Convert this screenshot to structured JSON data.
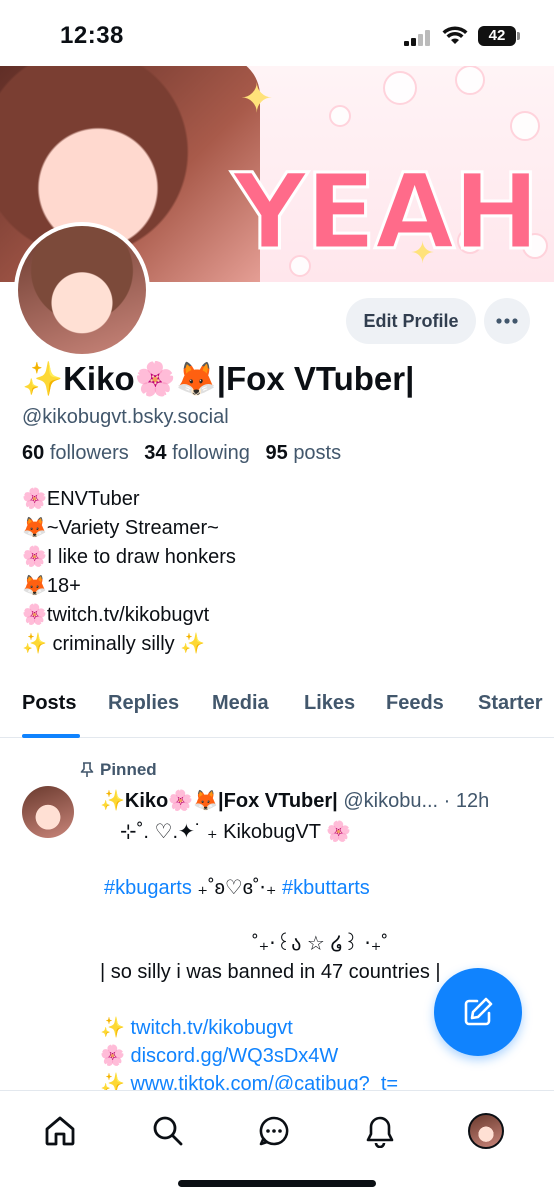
{
  "status_bar": {
    "time": "12:38",
    "battery": "42"
  },
  "profile": {
    "display_name": "✨Kiko🌸🦊|Fox VTuber|",
    "handle": "@kikobugvt.bsky.social",
    "edit_label": "Edit Profile",
    "followers_count": "60",
    "followers_label": "followers",
    "following_count": "34",
    "following_label": "following",
    "posts_count": "95",
    "posts_label": "posts",
    "bio": [
      "🌸ENVTuber",
      "🦊~Variety Streamer~",
      "🌸I like to draw honkers",
      "🦊18+",
      "🌸twitch.tv/kikobugvt",
      "✨ criminally silly ✨"
    ]
  },
  "tabs": [
    "Posts",
    "Replies",
    "Media",
    "Likes",
    "Feeds",
    "Starter"
  ],
  "post": {
    "pinned_label": "Pinned",
    "author": "✨Kiko🌸🦊|Fox VTuber|",
    "meta": "@kikobu... · 12h",
    "line1": "⊹˚. ♡.✦˙ ₊ KikobugVT 🌸",
    "hashtag1": "#kbugarts",
    "deco": " ₊˚ʚ♡ɞ˚⋅₊ ",
    "hashtag2": "#kbuttarts",
    "line3": "˚₊‧꒰ა ☆ ໒꒱ ‧₊˚",
    "line4": "| so silly i was banned in 47 countries |",
    "link1_prefix": "✨ ",
    "link1": "twitch.tv/kikobugvt",
    "link2_prefix": "🌸 ",
    "link2": "discord.gg/WQ3sDx4W",
    "link3_prefix": "✨ ",
    "link3": "www.tiktok.com/@catibug?_t="
  },
  "colors": {
    "accent": "#1083fe",
    "muted": "#42576c",
    "chip": "#eef1f5"
  },
  "icons": [
    "home-icon",
    "search-icon",
    "chat-icon",
    "bell-icon",
    "pin-icon",
    "compose-icon",
    "more-icon"
  ]
}
